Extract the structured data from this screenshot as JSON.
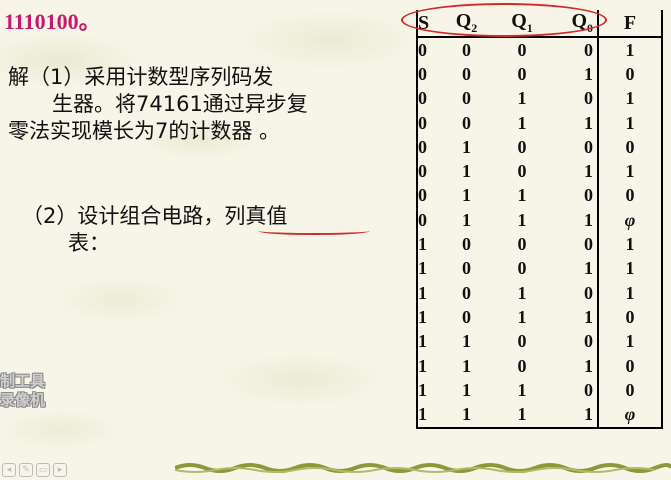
{
  "headline": "1110100。",
  "solution": {
    "step1_line1": "解（1）采用计数型序列码发",
    "step1_line2": "生器。将74161通过异步复",
    "step1_line3": "零法实现模长为7的计数器 。",
    "step2_line1": "（2）设计组合电路，列真值",
    "step2_line2": "表："
  },
  "watermark": {
    "line1": "制工具",
    "line2": "录像机"
  },
  "toolbar_icons": [
    "prev-icon",
    "pen-icon",
    "pointer-icon",
    "next-icon"
  ],
  "truth_table": {
    "headers": {
      "s": "S",
      "q2": "Q",
      "q2_sub": "2",
      "q1": "Q",
      "q1_sub": "1",
      "q0": "Q",
      "q0_sub": "0",
      "f": "F"
    },
    "rows": [
      {
        "s": "0",
        "q2": "0",
        "q1": "0",
        "q0": "0",
        "f": "1"
      },
      {
        "s": "0",
        "q2": "0",
        "q1": "0",
        "q0": "1",
        "f": "0"
      },
      {
        "s": "0",
        "q2": "0",
        "q1": "1",
        "q0": "0",
        "f": "1"
      },
      {
        "s": "0",
        "q2": "0",
        "q1": "1",
        "q0": "1",
        "f": "1"
      },
      {
        "s": "0",
        "q2": "1",
        "q1": "0",
        "q0": "0",
        "f": "0"
      },
      {
        "s": "0",
        "q2": "1",
        "q1": "0",
        "q0": "1",
        "f": "1"
      },
      {
        "s": "0",
        "q2": "1",
        "q1": "1",
        "q0": "0",
        "f": "0"
      },
      {
        "s": "0",
        "q2": "1",
        "q1": "1",
        "q0": "1",
        "f": "φ"
      },
      {
        "s": "1",
        "q2": "0",
        "q1": "0",
        "q0": "0",
        "f": "1"
      },
      {
        "s": "1",
        "q2": "0",
        "q1": "0",
        "q0": "1",
        "f": "1"
      },
      {
        "s": "1",
        "q2": "0",
        "q1": "1",
        "q0": "0",
        "f": "1"
      },
      {
        "s": "1",
        "q2": "0",
        "q1": "1",
        "q0": "1",
        "f": "0"
      },
      {
        "s": "1",
        "q2": "1",
        "q1": "0",
        "q0": "0",
        "f": "1"
      },
      {
        "s": "1",
        "q2": "1",
        "q1": "0",
        "q0": "1",
        "f": "0"
      },
      {
        "s": "1",
        "q2": "1",
        "q1": "1",
        "q0": "0",
        "f": "0"
      },
      {
        "s": "1",
        "q2": "1",
        "q1": "1",
        "q0": "1",
        "f": "φ"
      }
    ]
  },
  "colors": {
    "headline": "#c8196e",
    "annotation": "#d12a2a",
    "vine": "#8a9a3a"
  }
}
